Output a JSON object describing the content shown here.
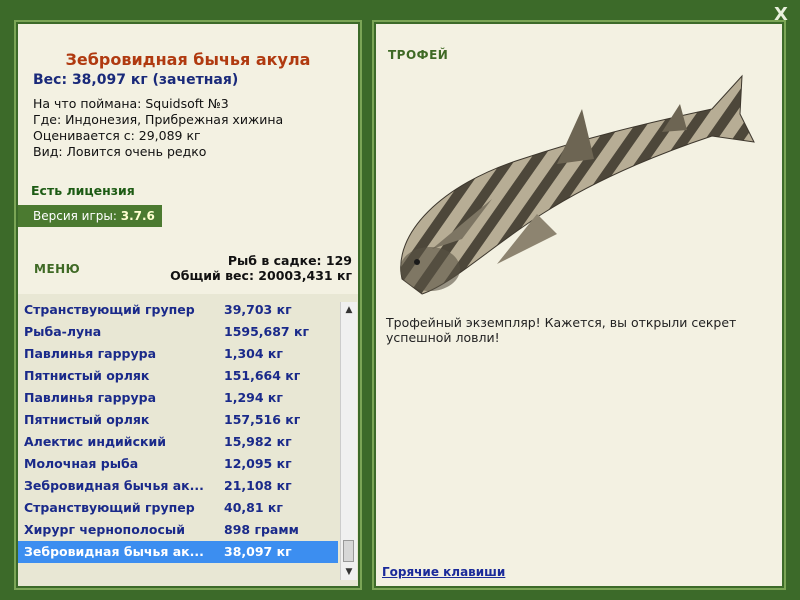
{
  "fish": {
    "title": "Зебровидная бычья акула",
    "weight": "Вес: 38,097 кг (зачетная)",
    "caught_with": "На что поймана: Squidsoft №3",
    "location": "Где: Индонезия, Прибрежная хижина",
    "estimated": "Оценивается с: 29,089 кг",
    "rarity": "Вид: Ловится очень редко"
  },
  "license": "Есть лицензия",
  "version": {
    "label": "Версия игры: ",
    "value": "3.7.6"
  },
  "menu_label": "МЕНЮ",
  "stats": {
    "fish_count": "Рыб в садке: 129",
    "total_weight": "Общий вес: 20003,431 кг"
  },
  "catch_list": [
    {
      "name": "Странствующий групер",
      "weight": "39,703 кг"
    },
    {
      "name": "Рыба-луна",
      "weight": "1595,687 кг"
    },
    {
      "name": "Павлинья гарруpа",
      "weight": "1,304 кг"
    },
    {
      "name": "Пятнистый орляк",
      "weight": "151,664 кг"
    },
    {
      "name": "Павлинья гарруpа",
      "weight": "1,294 кг"
    },
    {
      "name": "Пятнистый орляк",
      "weight": "157,516 кг"
    },
    {
      "name": "Алектис индийский",
      "weight": "15,982 кг"
    },
    {
      "name": "Молочная рыба",
      "weight": "12,095 кг"
    },
    {
      "name": "Зебровидная бычья ак...",
      "weight": "21,108 кг"
    },
    {
      "name": "Странствующий групер",
      "weight": "40,81 кг"
    },
    {
      "name": "Хирург чернополосый",
      "weight": "898 грамм"
    },
    {
      "name": "Зебровидная бычья ак...",
      "weight": "38,097 кг"
    }
  ],
  "selected_index": 11,
  "trophy_label": "ТРОФЕЙ",
  "trophy_text": "Трофейный экземпляр! Кажется, вы открыли секрет успешной ловли!",
  "hotkeys_label": "Горячие клавиши",
  "close_label": "X",
  "colors": {
    "background": "#3c6a29",
    "panel": "#f3f1e2",
    "accent": "#b03a10",
    "selection": "#3c8ef0"
  }
}
